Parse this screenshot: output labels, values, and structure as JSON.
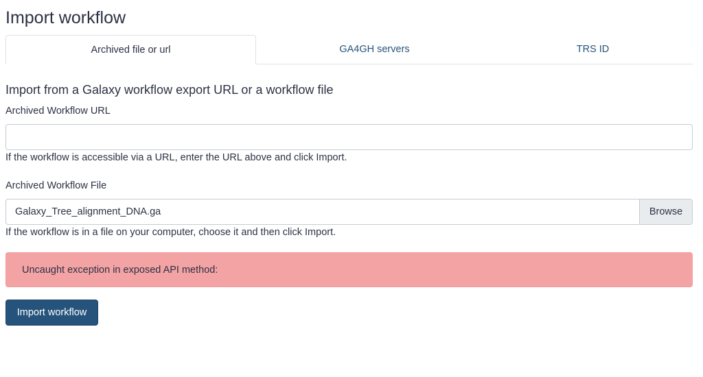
{
  "page": {
    "title": "Import workflow"
  },
  "tabs": [
    {
      "label": "Archived file or url",
      "active": true
    },
    {
      "label": "GA4GH servers",
      "active": false
    },
    {
      "label": "TRS ID",
      "active": false
    }
  ],
  "form": {
    "heading": "Import from a Galaxy workflow export URL or a workflow file",
    "url_label": "Archived Workflow URL",
    "url_value": "",
    "url_help": "If the workflow is accessible via a URL, enter the URL above and click Import.",
    "file_label": "Archived Workflow File",
    "file_name": "Galaxy_Tree_alignment_DNA.ga",
    "browse_label": "Browse",
    "file_help": "If the workflow is in a file on your computer, choose it and then click Import."
  },
  "alert": {
    "message": "Uncaught exception in exposed API method:",
    "color": "#f4a3a5"
  },
  "actions": {
    "import_label": "Import workflow",
    "primary_color": "#25537b"
  }
}
